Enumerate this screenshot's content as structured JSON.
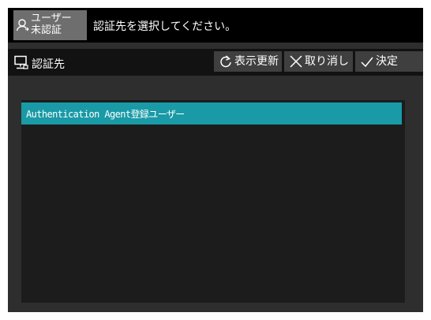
{
  "topbar": {
    "user_status": {
      "line1": "ユーザー",
      "line2": "未認証",
      "icon": "user-icon"
    },
    "prompt": "認証先を選択してください。"
  },
  "header": {
    "icon": "monitor-icon",
    "title": "認証先",
    "buttons": {
      "refresh": {
        "label": "表示更新",
        "icon": "refresh-icon"
      },
      "cancel": {
        "label": "取り消し",
        "icon": "close-icon"
      },
      "ok": {
        "label": "決定",
        "icon": "check-icon"
      }
    }
  },
  "list": {
    "items": [
      {
        "label": "Authentication Agent登録ユーザー",
        "selected": true
      }
    ]
  },
  "colors": {
    "selected_row": "#199aa6",
    "background": "#2e2e2e",
    "topbar": "#000000"
  }
}
